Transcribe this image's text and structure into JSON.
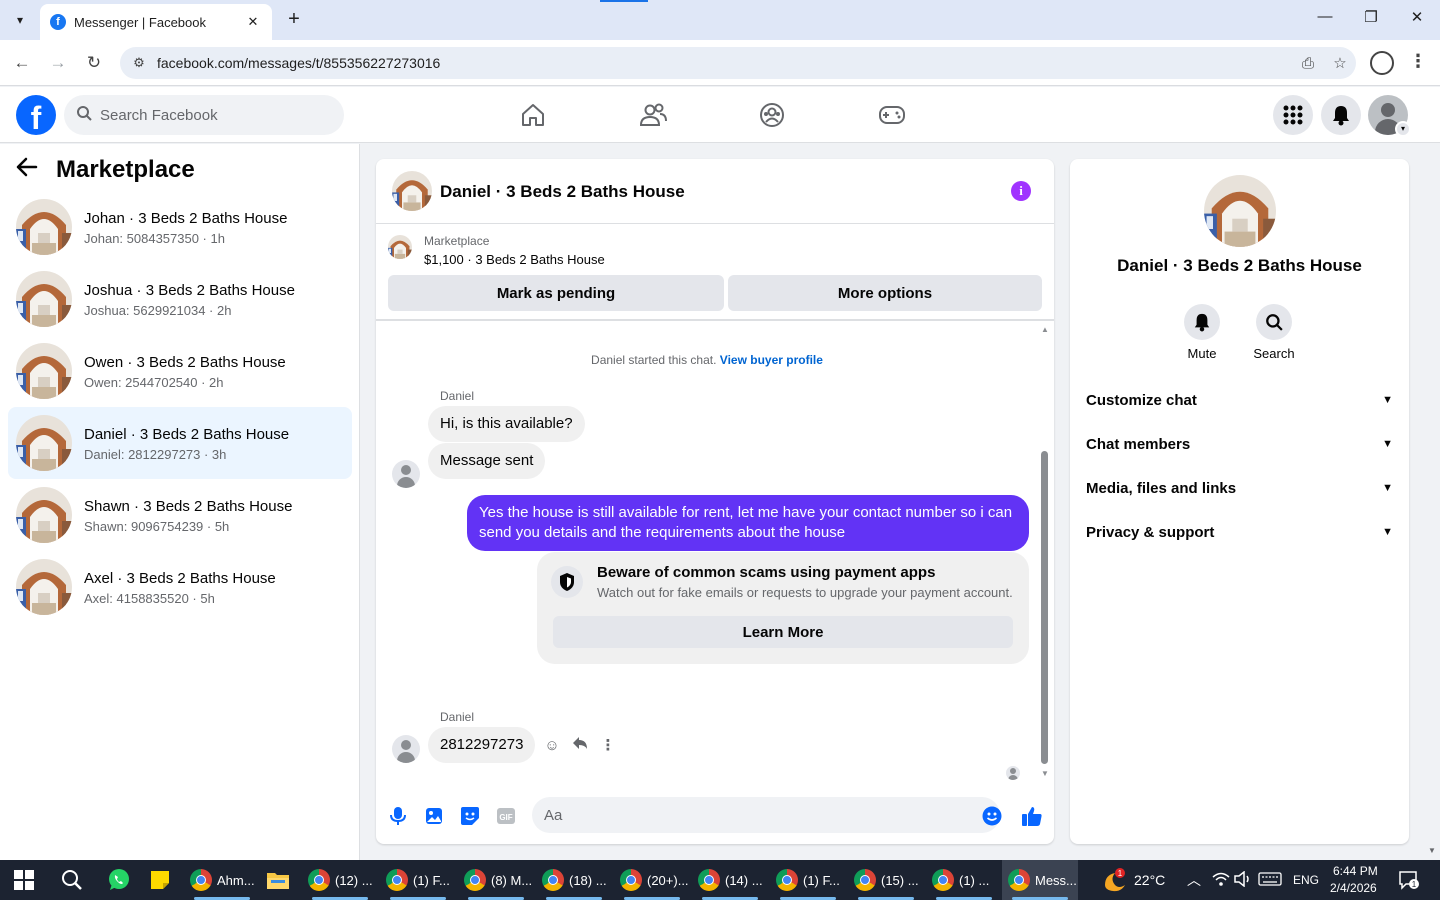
{
  "browser": {
    "tab_title": "Messenger | Facebook",
    "url": "facebook.com/messages/t/855356227273016"
  },
  "fb": {
    "search_placeholder": "Search Facebook"
  },
  "sidebar": {
    "title": "Marketplace",
    "conversations": [
      {
        "name": "Johan · 3 Beds 2 Baths House",
        "preview": "Johan: 5084357350 · 1h"
      },
      {
        "name": "Joshua · 3 Beds 2 Baths House",
        "preview": "Joshua: 5629921034 · 2h"
      },
      {
        "name": "Owen · 3 Beds 2 Baths House",
        "preview": "Owen: 2544702540 · 2h"
      },
      {
        "name": "Daniel · 3 Beds 2 Baths House",
        "preview": "Daniel: 2812297273 · 3h"
      },
      {
        "name": "Shawn · 3 Beds 2 Baths House",
        "preview": "Shawn: 9096754239 · 5h"
      },
      {
        "name": "Axel · 3 Beds 2 Baths House",
        "preview": "Axel: 4158835520 · 5h"
      }
    ]
  },
  "chat": {
    "title": "Daniel · 3 Beds 2 Baths House",
    "listing_source": "Marketplace",
    "listing_desc": "$1,100 · 3 Beds 2 Baths House",
    "mark_pending": "Mark as pending",
    "more_options": "More options",
    "started_text": "Daniel started this chat.",
    "started_link": "View buyer profile",
    "sender1": "Daniel",
    "msg1": "Hi, is this available?",
    "msg2": "Message sent",
    "out_msg": "Yes the house is still available for rent, let me have your contact number so i can send you details and the requirements about the house",
    "scam_title": "Beware of common scams using payment apps",
    "scam_body": "Watch out for fake emails or requests to upgrade your payment account.",
    "learn_more": "Learn More",
    "sender2": "Daniel",
    "msg3": "2812297273",
    "composer_placeholder": "Aa"
  },
  "info": {
    "title": "Daniel · 3 Beds 2 Baths House",
    "mute": "Mute",
    "search": "Search",
    "sections": [
      "Customize chat",
      "Chat members",
      "Media, files and links",
      "Privacy & support"
    ]
  },
  "taskbar": {
    "apps": [
      "Ahm...",
      "(12) ...",
      "(1) F...",
      "(8) M...",
      "(18) ...",
      "(20+)...",
      "(14) ...",
      "(1) F...",
      "(15) ...",
      "(1) ...",
      "Mess..."
    ],
    "weather": "22°C",
    "weather_badge": "1",
    "lang": "ENG",
    "time": "6:44 PM",
    "date": "2/4/2026",
    "notif_count": "1"
  },
  "colors": {
    "fb_blue": "#0866ff",
    "outgoing_bubble": "#6233f5",
    "info_purple": "#a033ff",
    "link_blue": "#0064d1",
    "active_row": "#ebf5ff"
  }
}
